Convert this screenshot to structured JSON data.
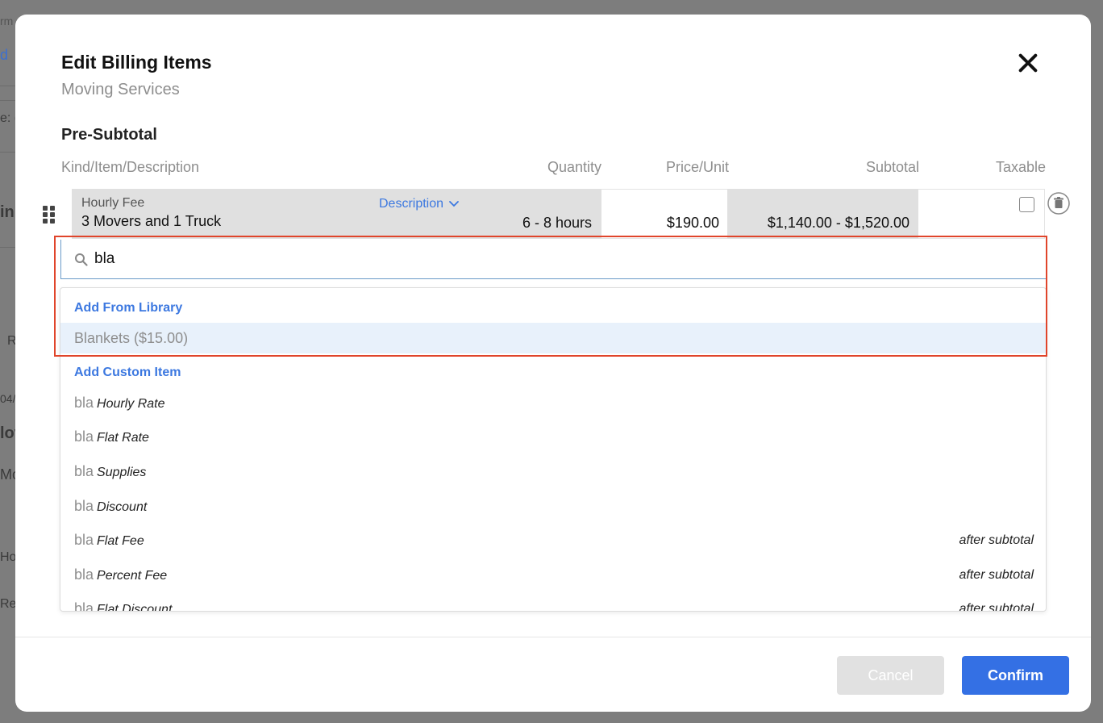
{
  "background": {
    "fragments": [
      "rm",
      "d",
      "e: (",
      "in",
      "R",
      "04/",
      "lov",
      "Mo",
      "Ho",
      "Re"
    ]
  },
  "modal": {
    "title": "Edit Billing Items",
    "subtitle": "Moving Services",
    "section_title": "Pre-Subtotal",
    "columns": {
      "kind": "Kind/Item/Description",
      "quantity": "Quantity",
      "price": "Price/Unit",
      "subtotal": "Subtotal",
      "taxable": "Taxable"
    },
    "row": {
      "kind": "Hourly Fee",
      "name": "3 Movers and 1 Truck",
      "description_label": "Description",
      "quantity": "6 - 8 hours",
      "price": "$190.00",
      "subtotal": "$1,140.00 - $1,520.00",
      "taxable": false
    },
    "search": {
      "value": "bla"
    },
    "dropdown": {
      "library_header": "Add From Library",
      "library_items": [
        "Blankets ($15.00)"
      ],
      "custom_header": "Add Custom Item",
      "custom_items": [
        {
          "prefix": "bla",
          "kind": "Hourly Rate",
          "note": ""
        },
        {
          "prefix": "bla",
          "kind": "Flat Rate",
          "note": ""
        },
        {
          "prefix": "bla",
          "kind": "Supplies",
          "note": ""
        },
        {
          "prefix": "bla",
          "kind": "Discount",
          "note": ""
        },
        {
          "prefix": "bla",
          "kind": "Flat Fee",
          "note": "after subtotal"
        },
        {
          "prefix": "bla",
          "kind": "Percent Fee",
          "note": "after subtotal"
        },
        {
          "prefix": "bla",
          "kind": "Flat Discount",
          "note": "after subtotal"
        }
      ]
    },
    "buttons": {
      "cancel": "Cancel",
      "confirm": "Confirm"
    }
  },
  "colors": {
    "accent": "#3470e4",
    "link": "#3c78e0",
    "highlight_border": "#e0452b",
    "selected_bg": "#e8f1fb"
  }
}
